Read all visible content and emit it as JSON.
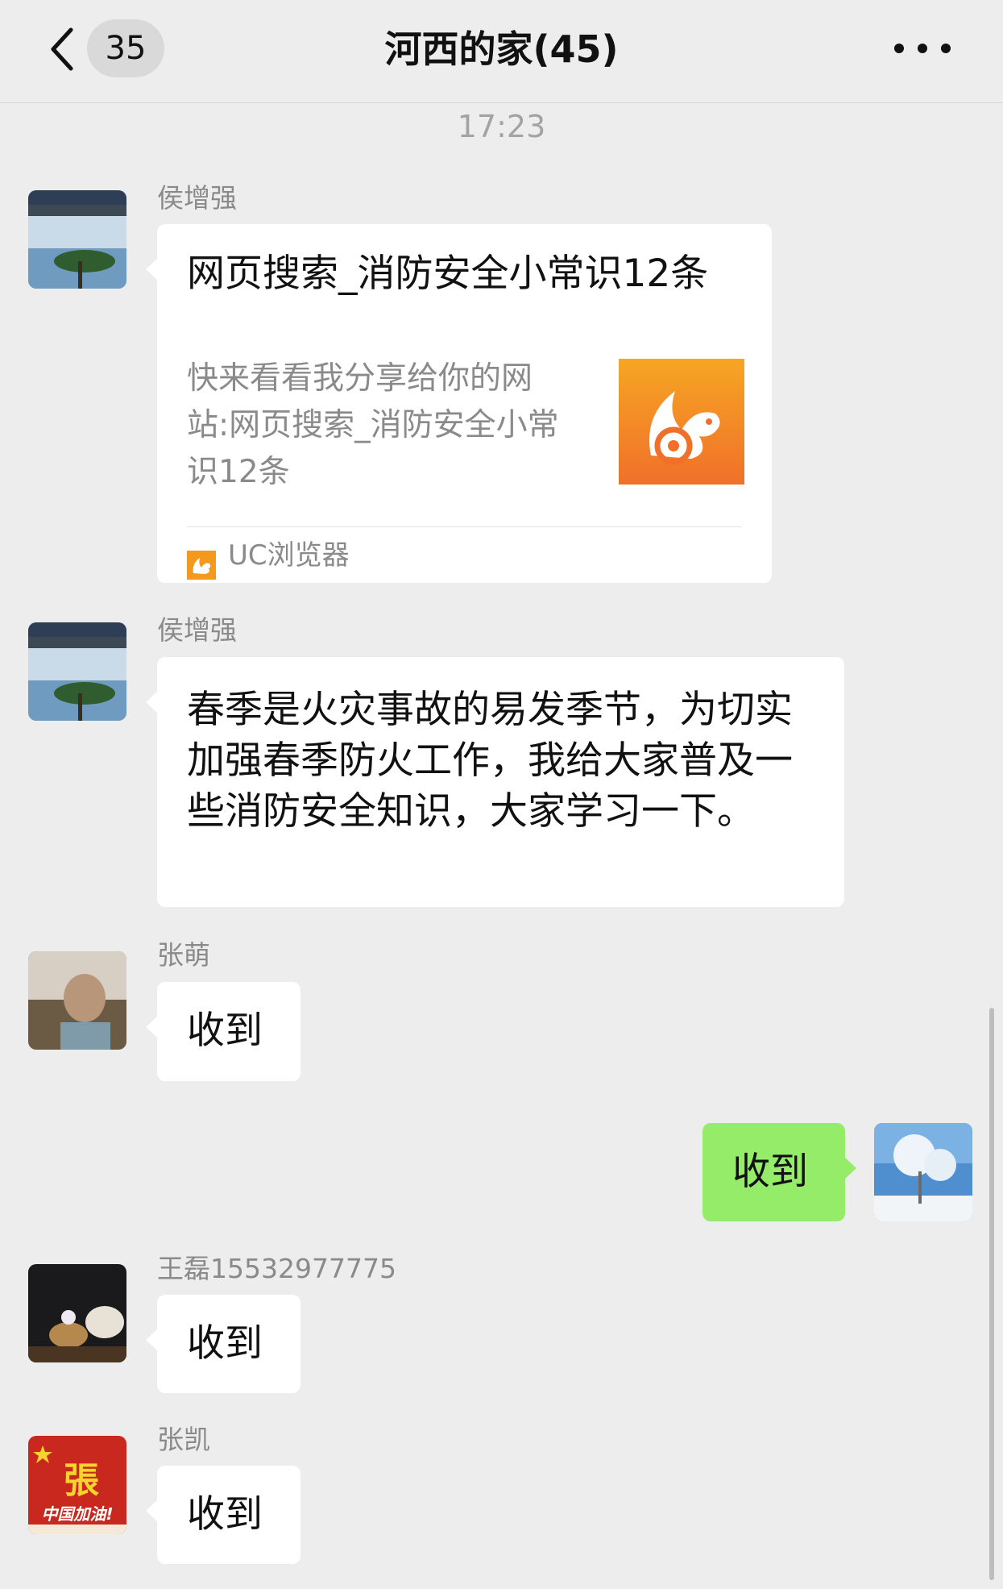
{
  "header": {
    "unread_count": "35",
    "title": "河西的家(45)",
    "back_icon": "chevron-left-icon",
    "more_icon": "more-dots-icon"
  },
  "timestamp": "17:23",
  "messages": [
    {
      "sender": "侯增强",
      "type": "link",
      "card": {
        "title": "网页搜索_消防安全小常识12条",
        "description": "快来看看我分享给你的网站:网页搜索_消防安全小常识12条",
        "source": "UC浏览器",
        "thumb_icon": "uc-browser-icon"
      }
    },
    {
      "sender": "侯增强",
      "type": "text",
      "text": "春季是火灾事故的易发季节，为切实加强春季防火工作，我给大家普及一些消防安全知识，大家学习一下。"
    },
    {
      "sender": "张萌",
      "type": "text",
      "text": "收到"
    },
    {
      "sender": "",
      "type": "text",
      "outgoing": true,
      "text": "收到"
    },
    {
      "sender": "王磊15532977775",
      "type": "text",
      "text": "收到"
    },
    {
      "sender": "张凯",
      "type": "text",
      "text": "收到",
      "avatar_text": "中国加油!",
      "avatar_glyph": "張"
    }
  ],
  "colors": {
    "background": "#ededed",
    "incoming_bubble": "#ffffff",
    "outgoing_bubble": "#95ec69",
    "uc_orange": "#f39a1e"
  }
}
